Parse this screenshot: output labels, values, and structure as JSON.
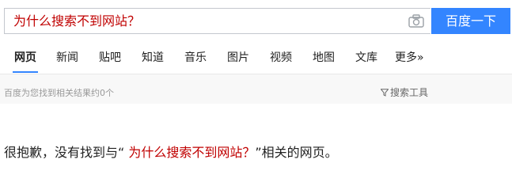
{
  "search": {
    "query": "为什么搜索不到网站？",
    "button_label": "百度一下"
  },
  "tabs": [
    {
      "label": "网页",
      "active": true
    },
    {
      "label": "新闻"
    },
    {
      "label": "贴吧"
    },
    {
      "label": "知道"
    },
    {
      "label": "音乐"
    },
    {
      "label": "图片"
    },
    {
      "label": "视频"
    },
    {
      "label": "地图"
    },
    {
      "label": "文库"
    },
    {
      "label": "更多»"
    }
  ],
  "results_bar": {
    "count_text": "百度为您找到相关结果约0个",
    "tools_label": "搜索工具"
  },
  "no_result": {
    "prefix": "很抱歉，没有找到与“",
    "query": " 为什么搜索不到网站？",
    "suffix": "”相关的网页。"
  },
  "colors": {
    "accent": "#3385ff",
    "query_red": "#c00000"
  },
  "icons": {
    "camera": "camera-icon",
    "filter": "funnel-icon"
  }
}
